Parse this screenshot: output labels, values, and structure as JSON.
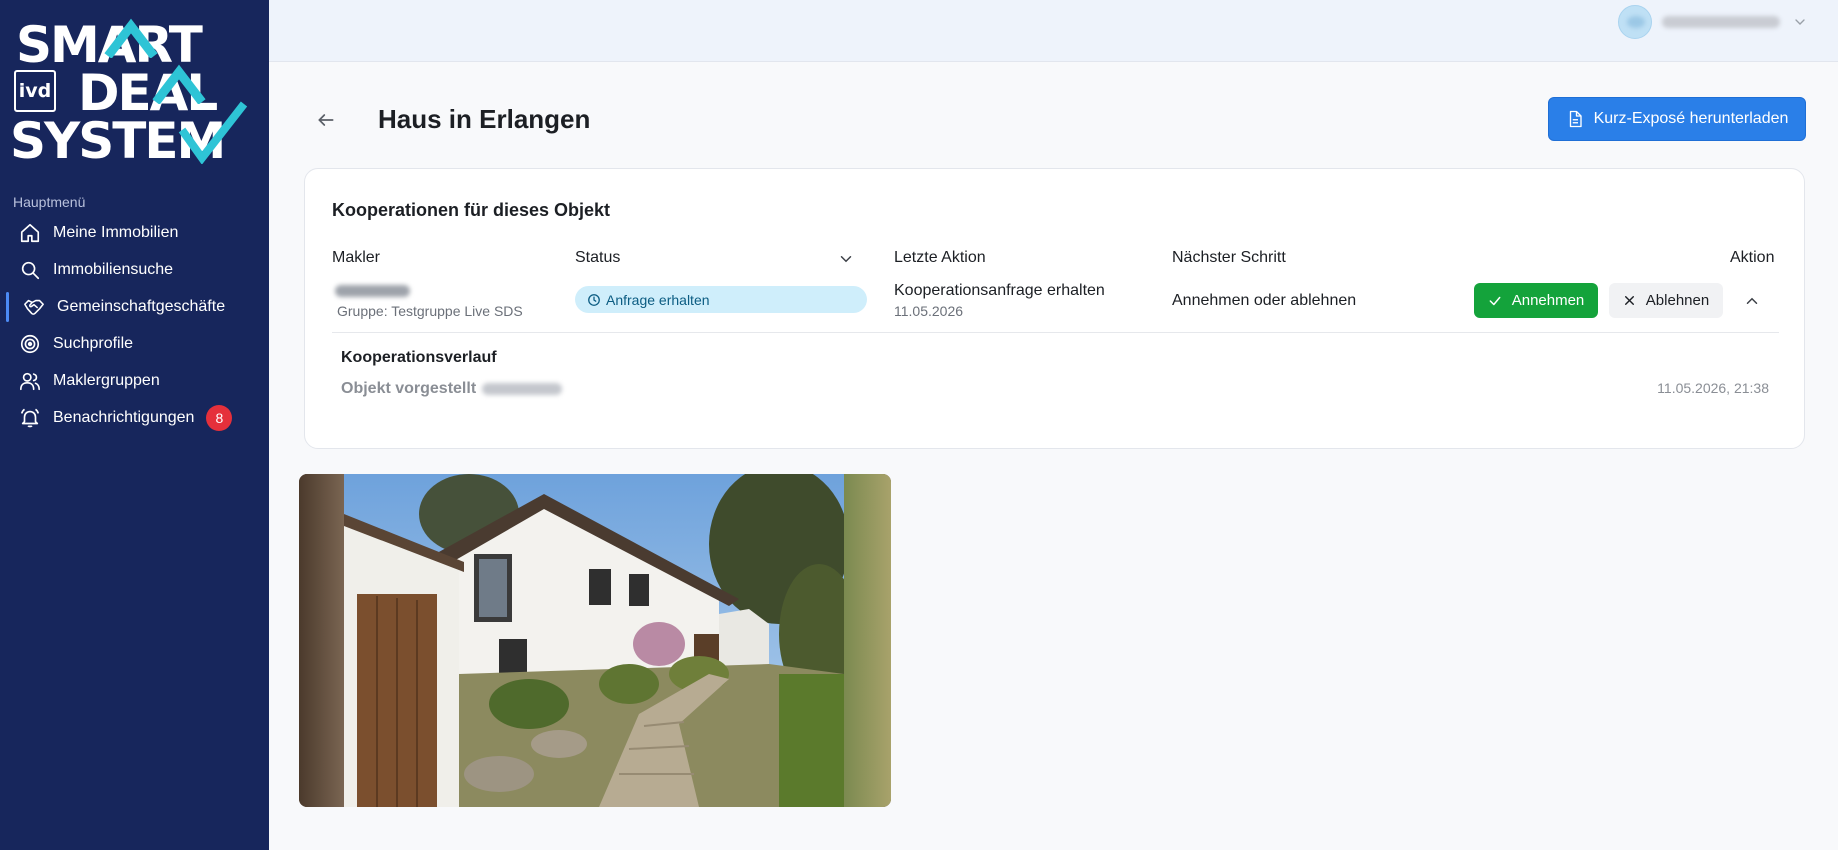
{
  "brand": {
    "logo_line1": "SMART",
    "logo_line2": "DEAL",
    "logo_line3": "SYSTEM",
    "logo_badge": "ivd",
    "colors": {
      "sidebar": "#17265c",
      "accent": "#2a7fe8",
      "roof": "#2ec4d6"
    }
  },
  "sidebar": {
    "section_label": "Hauptmenü",
    "items": [
      {
        "label": "Meine Immobilien",
        "icon": "home-icon"
      },
      {
        "label": "Immobiliensuche",
        "icon": "search-icon"
      },
      {
        "label": "Gemeinschaftgeschäfte",
        "icon": "handshake-icon",
        "active": true
      },
      {
        "label": "Suchprofile",
        "icon": "target-icon"
      },
      {
        "label": "Maklergruppen",
        "icon": "users-icon"
      },
      {
        "label": "Benachrichtigungen",
        "icon": "bell-icon",
        "badge": "8"
      }
    ]
  },
  "page": {
    "title": "Haus in Erlangen",
    "download_button": "Kurz-Exposé herunterladen"
  },
  "cooperations": {
    "title": "Kooperationen für dieses Objekt",
    "columns": {
      "makler": "Makler",
      "status": "Status",
      "last_action": "Letzte Aktion",
      "next_step": "Nächster Schritt",
      "action": "Aktion"
    },
    "row": {
      "group": "Gruppe: Testgruppe Live SDS",
      "status": "Anfrage erhalten",
      "last_action": "Kooperationsanfrage erhalten",
      "last_action_date": "11.05.2026",
      "next_step": "Annehmen oder ablehnen",
      "accept_label": "Annehmen",
      "reject_label": "Ablehnen"
    },
    "history": {
      "title": "Kooperationsverlauf",
      "entry": "Objekt vorgestellt",
      "entry_time": "11.05.2026, 21:38"
    }
  }
}
